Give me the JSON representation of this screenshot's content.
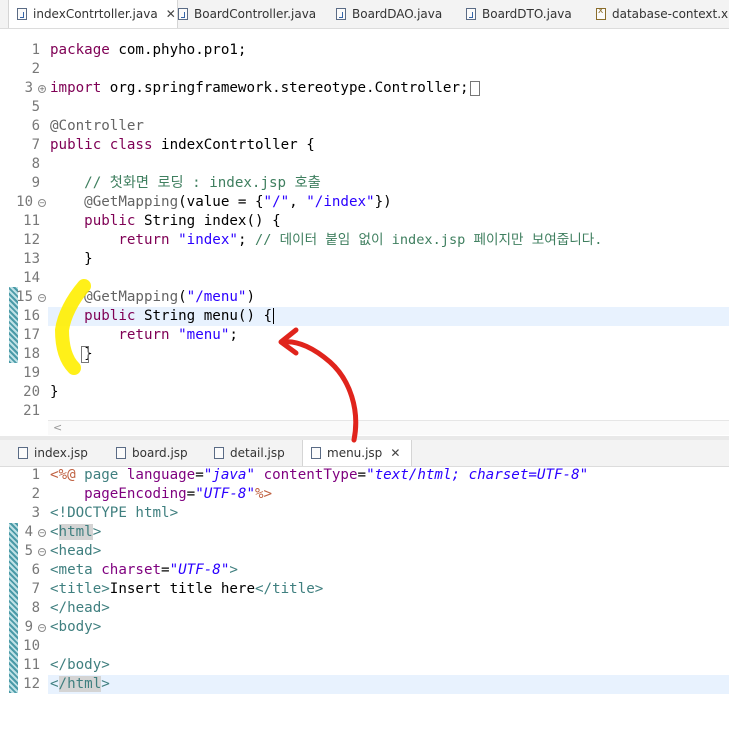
{
  "top_editor": {
    "tabs": [
      {
        "label": "indexContrtoller.java",
        "icon": "java-file-icon",
        "active": true
      },
      {
        "label": "BoardController.java",
        "icon": "java-file-icon"
      },
      {
        "label": "BoardDAO.java",
        "icon": "java-file-icon"
      },
      {
        "label": "BoardDTO.java",
        "icon": "java-file-icon"
      },
      {
        "label": "database-context.xml",
        "icon": "xml-file-icon"
      }
    ],
    "close_glyph": "✕",
    "line_numbers": [
      "1",
      "2",
      "3",
      "5",
      "6",
      "7",
      "8",
      "9",
      "10",
      "11",
      "12",
      "13",
      "14",
      "15",
      "16",
      "17",
      "18",
      "19",
      "20",
      "21"
    ],
    "fold_glyphs": {
      "collapsed": "+",
      "expanded": "−"
    },
    "code": {
      "l1_kw": "package",
      "l1_rest": " com.phyho.pro1;",
      "l3_kw": "import",
      "l3_rest": " org.springframework.stereotype.Controller;",
      "l6_an": "@Controller",
      "l7_kw1": "public",
      "l7_kw2": "class",
      "l7_rest": " indexContrtoller {",
      "l9_cm": "    // 첫화면 로딩 : index.jsp 호출",
      "l10_an": "    @GetMapping",
      "l10_a": "(value = {",
      "l10_s1": "\"/\"",
      "l10_b": ", ",
      "l10_s2": "\"/index\"",
      "l10_c": "})",
      "l11_ind": "    ",
      "l11_kw": "public",
      "l11_rest": " String index() {",
      "l12_ind": "        ",
      "l12_kw": "return",
      "l12_sp": " ",
      "l12_str": "\"index\"",
      "l12_semi": "; ",
      "l12_cm": "// 데이터 붙임 없이 index.jsp 페이지만 보여줍니다.",
      "l13": "    }",
      "l15_an": "    @GetMapping",
      "l15_a": "(",
      "l15_str": "\"/menu\"",
      "l15_b": ")",
      "l16_ind": "    ",
      "l16_kw": "public",
      "l16_rest": " String menu() {",
      "l17_ind": "        ",
      "l17_kw": "return",
      "l17_sp": " ",
      "l17_str": "\"menu\"",
      "l17_semi": ";",
      "l18": "    }",
      "l20": "}"
    },
    "scroll_left_glyph": "<"
  },
  "bottom_editor": {
    "tabs": [
      {
        "label": "index.jsp",
        "icon": "jsp-file-icon"
      },
      {
        "label": "board.jsp",
        "icon": "jsp-file-icon"
      },
      {
        "label": "detail.jsp",
        "icon": "jsp-file-icon"
      },
      {
        "label": "menu.jsp",
        "icon": "jsp-file-icon",
        "active": true
      }
    ],
    "close_glyph": "✕",
    "line_numbers": [
      "1",
      "2",
      "3",
      "4",
      "5",
      "6",
      "7",
      "8",
      "9",
      "10",
      "11",
      "12"
    ],
    "code": {
      "l1_dir": "<%@",
      "l1_page": " page ",
      "l1_a1": "language",
      "l1_eq1": "=",
      "l1_v1": "\"java\"",
      "l1_sp": " ",
      "l1_a2": "contentType",
      "l1_eq2": "=",
      "l1_v2": "\"text/html; charset=UTF-8\"",
      "l2_ind": "    ",
      "l2_a": "pageEncoding",
      "l2_eq": "=",
      "l2_v": "\"UTF-8\"",
      "l2_dir": "%>",
      "l3": "<!DOCTYPE html>",
      "l4_o": "<",
      "l4_t": "html",
      "l4_c": ">",
      "l5": "<head>",
      "l6_o": "<meta ",
      "l6_a": "charset",
      "l6_eq": "=",
      "l6_v": "\"UTF-8\"",
      "l6_c": ">",
      "l7_o": "<title>",
      "l7_text": "Insert title here",
      "l7_c": "</title>",
      "l8": "</head>",
      "l9": "<body>",
      "l11": "</body>",
      "l12_o": "<",
      "l12_t": "/html",
      "l12_c": ">"
    }
  },
  "colors": {
    "keyword": "#7f0055",
    "string": "#2a00ff",
    "comment": "#3f7f5f",
    "annotation": "#646464",
    "highlighter": "#ffee00",
    "arrow": "#e0241c",
    "current_line": "#e8f2fe"
  }
}
